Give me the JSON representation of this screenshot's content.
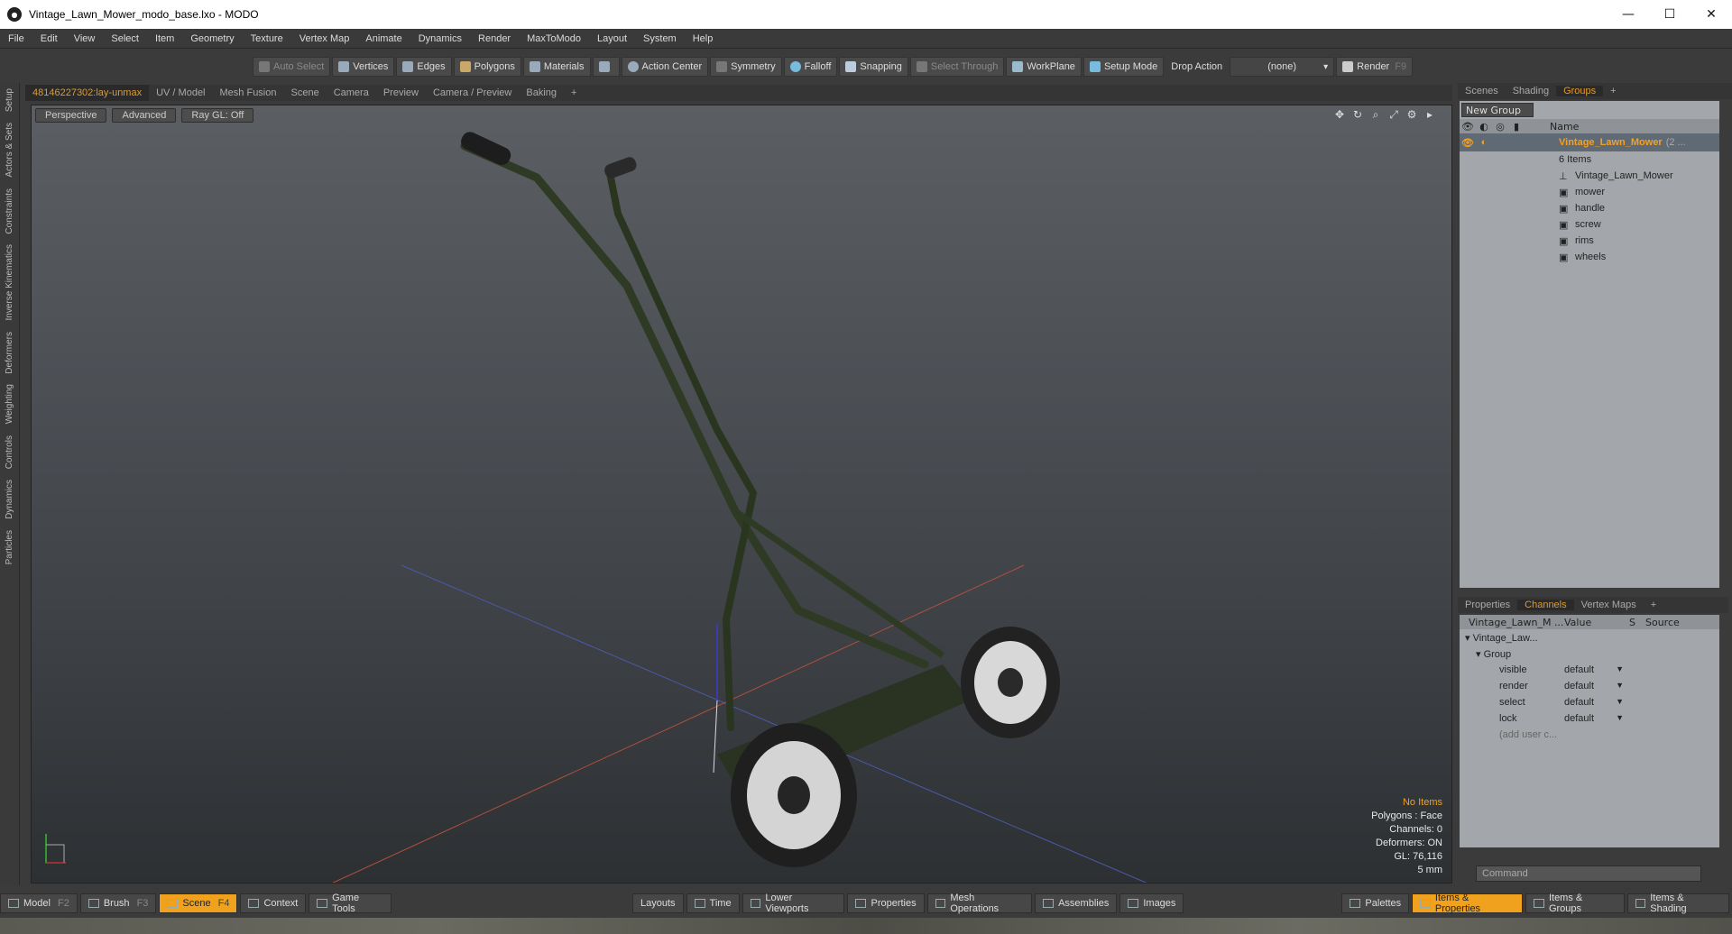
{
  "window": {
    "title": "Vintage_Lawn_Mower_modo_base.lxo - MODO",
    "minimize": "—",
    "maximize": "☐",
    "close": "✕"
  },
  "menu": [
    "File",
    "Edit",
    "View",
    "Select",
    "Item",
    "Geometry",
    "Texture",
    "Vertex Map",
    "Animate",
    "Dynamics",
    "Render",
    "MaxToModo",
    "Layout",
    "System",
    "Help"
  ],
  "toolbar": {
    "auto_select": "Auto Select",
    "vertices": "Vertices",
    "edges": "Edges",
    "polygons": "Polygons",
    "materials": "Materials",
    "action_center": "Action Center",
    "symmetry": "Symmetry",
    "falloff": "Falloff",
    "snapping": "Snapping",
    "select_through": "Select Through",
    "workplane": "WorkPlane",
    "setup_mode": "Setup Mode",
    "drop_action": "Drop Action",
    "drop_value": "(none)",
    "render": "Render",
    "render_key": "F9"
  },
  "left_tabs": [
    "Setup",
    "Actors & Sets",
    "Constraints",
    "Inverse Kinematics",
    "Deformers",
    "Weighting",
    "Controls",
    "Dynamics",
    "Particles"
  ],
  "view_tabs": [
    "48146227302:lay-unmax",
    "UV / Model",
    "Mesh Fusion",
    "Scene",
    "Camera",
    "Preview",
    "Camera / Preview",
    "Baking",
    "+"
  ],
  "viewport": {
    "buttons": [
      "Perspective",
      "Advanced",
      "Ray GL: Off"
    ],
    "info": {
      "no_items": "No Items",
      "polygons": "Polygons : Face",
      "channels": "Channels: 0",
      "deformers": "Deformers: ON",
      "gl": "GL: 76,116",
      "scale": "5 mm"
    }
  },
  "right_tabs_top": [
    "Scenes",
    "Shading",
    "Groups",
    "+"
  ],
  "groups": {
    "new_group": "New Group",
    "name_header": "Name",
    "main_item": "Vintage_Lawn_Mower",
    "main_suffix": "(2 ...",
    "count": "6 Items",
    "children": [
      "Vintage_Lawn_Mower",
      "mower",
      "handle",
      "screw",
      "rims",
      "wheels"
    ]
  },
  "right_tabs_bottom": [
    "Properties",
    "Channels",
    "Vertex Maps",
    "+"
  ],
  "channels": {
    "headers": [
      "Vintage_Lawn_M ...",
      "Value",
      "S",
      "Source"
    ],
    "root": "Vintage_Law...",
    "group": "Group",
    "rows": [
      {
        "name": "visible",
        "value": "default"
      },
      {
        "name": "render",
        "value": "default"
      },
      {
        "name": "select",
        "value": "default"
      },
      {
        "name": "lock",
        "value": "default"
      }
    ],
    "add_user": "(add user c..."
  },
  "command_placeholder": "Command",
  "bottom": {
    "left": [
      {
        "label": "Model",
        "key": "F2",
        "active": false
      },
      {
        "label": "Brush",
        "key": "F3",
        "active": false
      },
      {
        "label": "Scene",
        "key": "F4",
        "active": true
      },
      {
        "label": "Context",
        "key": "",
        "active": false
      },
      {
        "label": "Game Tools",
        "key": "",
        "active": false
      }
    ],
    "center": [
      "Layouts",
      "Time",
      "Lower Viewports",
      "Properties",
      "Mesh Operations",
      "Assemblies",
      "Images"
    ],
    "right": [
      {
        "label": "Palettes",
        "active": false
      },
      {
        "label": "Items & Properties",
        "active": true
      },
      {
        "label": "Items & Groups",
        "active": false
      },
      {
        "label": "Items & Shading",
        "active": false
      }
    ]
  }
}
